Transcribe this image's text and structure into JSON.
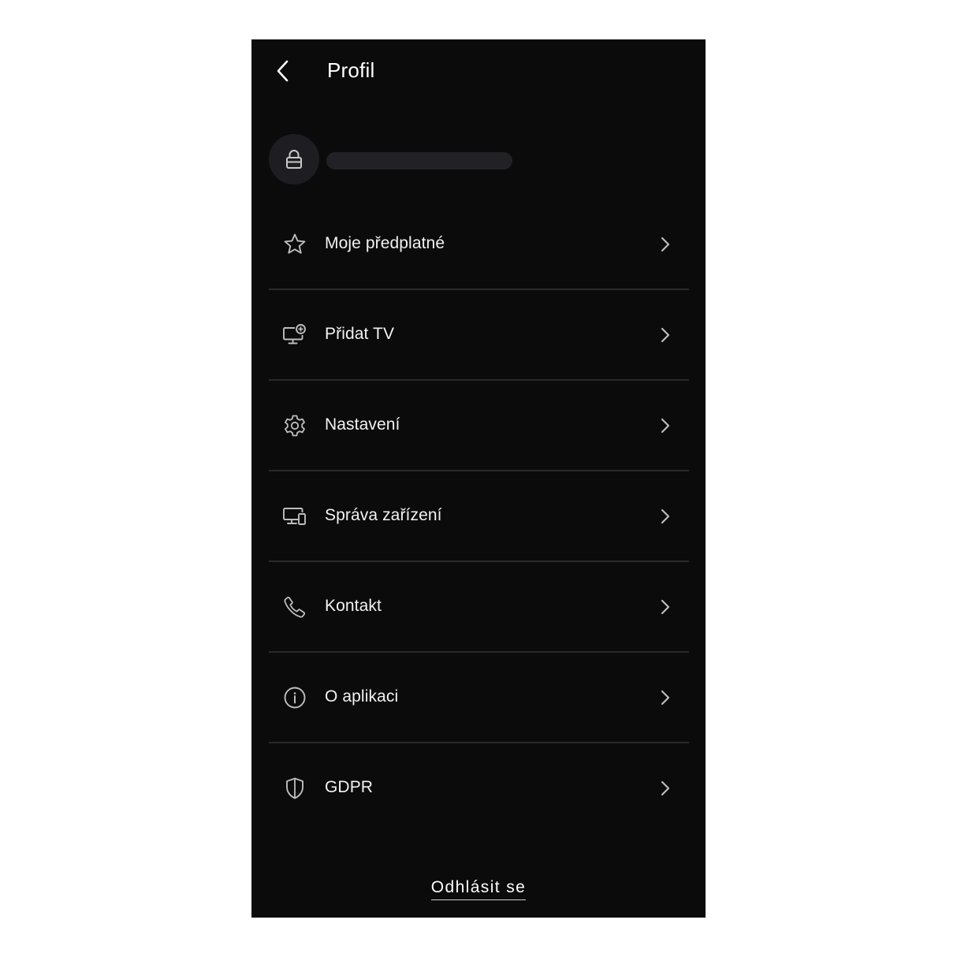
{
  "header": {
    "title": "Profil",
    "back_icon": "chevron-left-icon"
  },
  "profile": {
    "avatar_icon": "lock-icon",
    "name": ""
  },
  "menu": {
    "items": [
      {
        "id": "subscription",
        "label": "Moje předplatné",
        "icon": "star-icon"
      },
      {
        "id": "add-tv",
        "label": "Přidat TV",
        "icon": "monitor-add-icon"
      },
      {
        "id": "settings",
        "label": "Nastavení",
        "icon": "gear-icon"
      },
      {
        "id": "devices",
        "label": "Správa zařízení",
        "icon": "devices-icon"
      },
      {
        "id": "contact",
        "label": "Kontakt",
        "icon": "phone-icon"
      },
      {
        "id": "about",
        "label": "O aplikaci",
        "icon": "info-icon"
      },
      {
        "id": "gdpr",
        "label": "GDPR",
        "icon": "shield-icon"
      }
    ]
  },
  "footer": {
    "logout_label": "Odhlásit se"
  },
  "colors": {
    "background": "#0b0b0c",
    "divider": "#2a2a2d",
    "avatar_bg": "#1e1e22",
    "text": "#f2f2f2",
    "icon": "#bdbdbd"
  }
}
